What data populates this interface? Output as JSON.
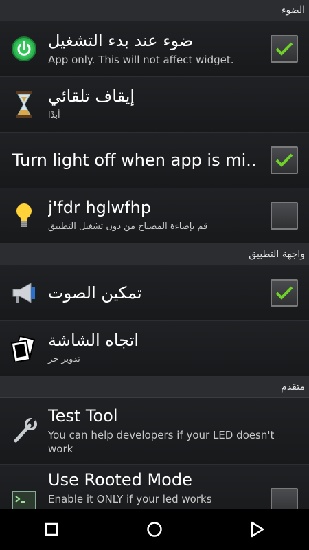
{
  "sections": [
    {
      "header": "الضوء"
    },
    {
      "header": "واجهة التطبيق"
    },
    {
      "header": "متقدم"
    }
  ],
  "rows": {
    "light_on_start": {
      "title": "ضوء عند بدء التشغيل",
      "subtitle": "App only. This will not affect widget.",
      "checked": true
    },
    "auto_off": {
      "title": "إيقاف تلقائي",
      "subtitle": "أبدًا"
    },
    "light_off_minimized": {
      "title": "Turn light off when app is mi..",
      "checked": true
    },
    "no_ui_light": {
      "title": "j'fdr hglwfhp",
      "subtitle": "قم بإضاءة المصباح من دون تشغيل التطبيق",
      "checked": false
    },
    "enable_sound": {
      "title": "تمكين الصوت",
      "checked": true
    },
    "orientation": {
      "title": "اتجاه الشاشة",
      "subtitle": "تدوير حر"
    },
    "test_tool": {
      "title": "Test Tool",
      "subtitle": "You can help developers if your LED doesn't work"
    },
    "rooted_mode": {
      "title": "Use Rooted Mode",
      "subtitle": "Enable it ONLY if your led works",
      "checked": false
    }
  },
  "colors": {
    "accent_green": "#6fd12a",
    "power_green": "#2bb24c"
  }
}
